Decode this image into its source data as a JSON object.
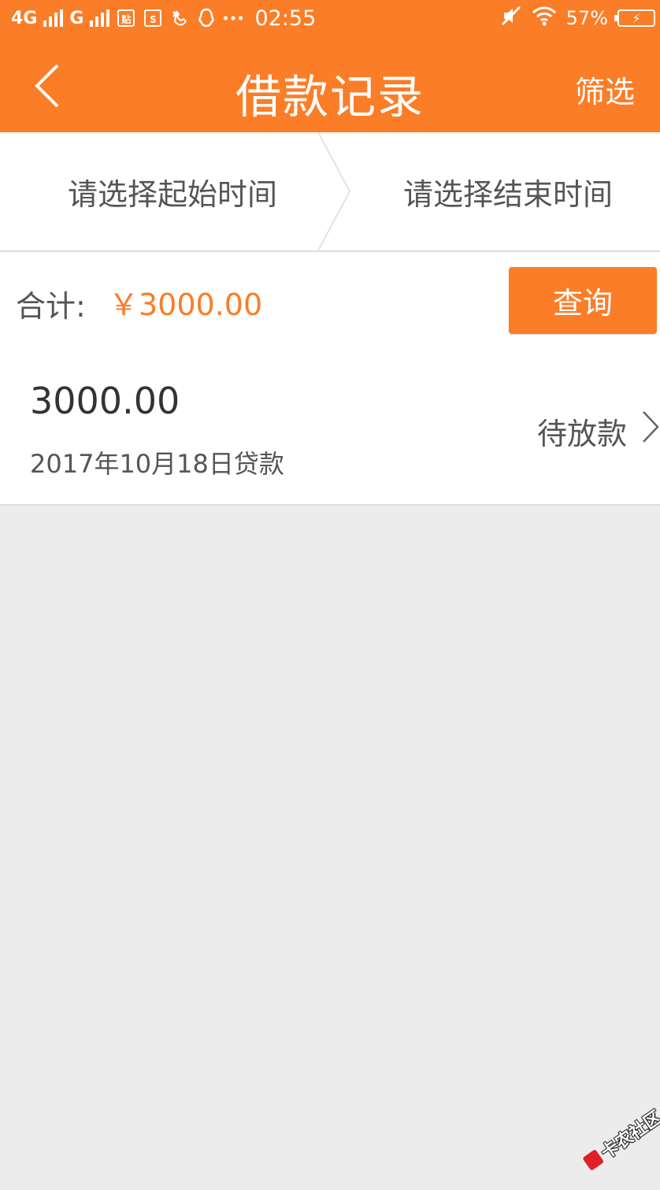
{
  "status_bar": {
    "network1": "4G",
    "network2": "G",
    "app_icon_1": "贴",
    "app_icon_2": "S",
    "time": "02:55",
    "battery_percent": "57%",
    "icons": [
      "signal-bars-icon",
      "tieba-icon",
      "screenshot-icon",
      "missed-call-icon",
      "qq-icon",
      "more-dots-icon",
      "mute-icon",
      "wifi-icon",
      "battery-charging-icon"
    ]
  },
  "header": {
    "title": "借款记录",
    "filter_label": "筛选",
    "back_icon": "chevron-left-icon"
  },
  "date_range": {
    "start_placeholder": "请选择起始时间",
    "end_placeholder": "请选择结束时间"
  },
  "summary": {
    "total_label": "合计:",
    "total_amount": "￥3000.00",
    "query_button": "查询"
  },
  "records": [
    {
      "amount": "3000.00",
      "date": "2017年10月18日贷款",
      "status": "待放款"
    }
  ],
  "watermark": {
    "text": "卡农社区"
  },
  "colors": {
    "accent": "#fb7d27",
    "background": "#ececec",
    "card": "#ffffff",
    "text_primary": "#333333",
    "text_secondary": "#555555"
  }
}
